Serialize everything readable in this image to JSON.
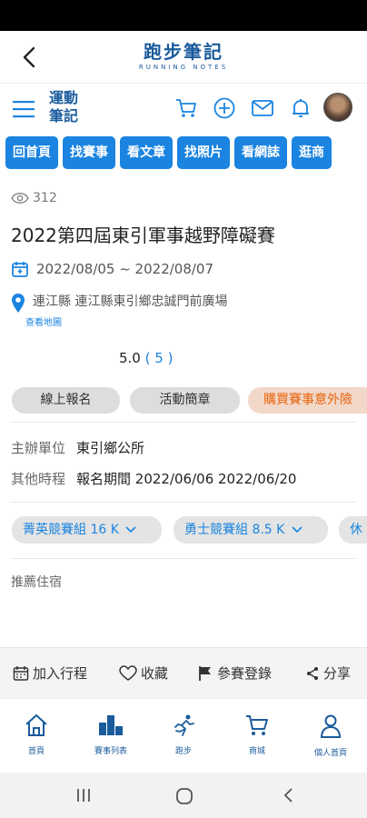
{
  "header": {
    "brand_zh": "跑步筆記",
    "brand_en": "RUNNING NOTES"
  },
  "nav": {
    "logo": "運動筆記"
  },
  "tabs": [
    "回首頁",
    "找賽事",
    "看文章",
    "找照片",
    "看網誌",
    "逛商"
  ],
  "event": {
    "views": "312",
    "title": "2022第四屆東引軍事越野障礙賽",
    "dates": "2022/08/05 ~ 2022/08/07",
    "location": "連江縣 連江縣東引鄉忠誠門前廣場",
    "map_link": "查看地圖",
    "rating": "5.0",
    "rating_count": "( 5 )"
  },
  "buttons": {
    "register": "線上報名",
    "brochure": "活動簡章",
    "insurance": "購買賽事意外險"
  },
  "info": {
    "organizer_label": "主辦單位",
    "organizer_value": "東引鄉公所",
    "schedule_label": "其他時程",
    "schedule_value": "報名期間 2022/06/06 2022/06/20"
  },
  "groups": [
    "菁英競賽組 16 K",
    "勇士競賽組 8.5 K",
    "休"
  ],
  "recommend_label": "推薦住宿",
  "actions": {
    "add_schedule": "加入行程",
    "favorite": "收藏",
    "participate": "參賽登錄",
    "share": "分享"
  },
  "bottom_nav": [
    "首頁",
    "賽事列表",
    "跑步",
    "商城",
    "個人首頁"
  ],
  "colors": {
    "primary": "#1a84e0",
    "brand": "#1a5b9c",
    "accent_orange": "#e8640c"
  }
}
